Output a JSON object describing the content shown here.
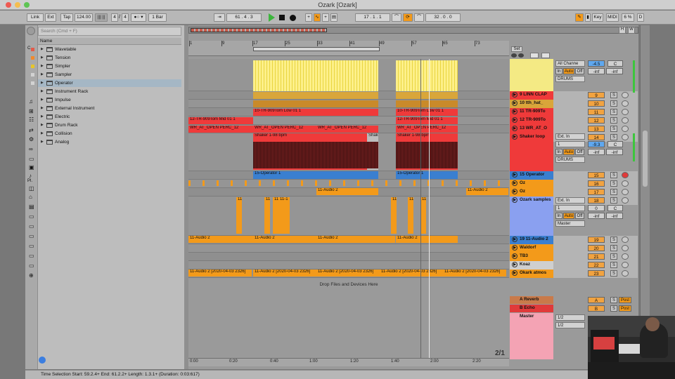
{
  "window": {
    "title": "Ozark  [Ozark]"
  },
  "control_bar": {
    "link": "Link",
    "ext": "Ext",
    "tap": "Tap",
    "tempo": "124.00",
    "sig_num": "4",
    "sig_den": "4",
    "quant": "1 Bar",
    "position": "61 .  4 .  3",
    "loop_start": "17 .  1 .  1",
    "loop_len": "32 .  0 .  0",
    "key": "Key",
    "midi": "MIDI",
    "cpu": "6 %",
    "d_btn": "D"
  },
  "browser": {
    "search_placeholder": "Search (Cmd + F)",
    "name_header": "Name",
    "items": [
      {
        "label": "Wavetable",
        "color": "#e35a4a"
      },
      {
        "label": "Tension",
        "color": "#f08a2d"
      },
      {
        "label": "Simpler",
        "color": "#e6c52a"
      },
      {
        "label": "Sampler",
        "color": "#d2d2d2"
      },
      {
        "label": "Operator",
        "color": "#d2d2d2"
      },
      {
        "label": "Instrument Rack"
      },
      {
        "label": "Impulse"
      },
      {
        "label": "External Instrument"
      },
      {
        "label": "Electric"
      },
      {
        "label": "Drum Rack"
      },
      {
        "label": "Collision"
      },
      {
        "label": "Analog"
      }
    ],
    "side_labels": [
      "C.",
      "Pl."
    ]
  },
  "ruler": {
    "bars": [
      "1",
      "9",
      "17",
      "25",
      "33",
      "41",
      "49",
      "57",
      "65",
      "73"
    ],
    "set_label": "Set"
  },
  "time_axis": [
    "0:00",
    "0:20",
    "0:40",
    "1:00",
    "1:20",
    "1:40",
    "2:00",
    "2:20"
  ],
  "arrangement": {
    "drop_text": "Drop Files and Devices Here",
    "page_indicator": "2/1",
    "clips": {
      "tom_low": "10-TR-909Tom Low 01 1",
      "tom_mid": "12-TR-909Tom Mid 01 1",
      "perc": "WR_AT_OPEN PERC_12",
      "shaker": "Shaker 1-98 bpm",
      "shaker_cut": "Shake",
      "operator": "15-Operator 1",
      "audio2": "11-Audio 2",
      "audio2_date": "11-Audio 2 [2020-04-03 2326]",
      "sample": "11-1"
    }
  },
  "tracks": [
    {
      "name": "9 LINN CLAP",
      "color": "#ef3a3a",
      "num": "9"
    },
    {
      "name": "10 tth_hat_",
      "color": "#d9a63a",
      "num": "10"
    },
    {
      "name": "11 TR-909To",
      "color": "#ef3a3a",
      "num": "11"
    },
    {
      "name": "12 TR-909To",
      "color": "#ef3a3a",
      "num": "12"
    },
    {
      "name": "13 WR_AT_O",
      "color": "#ef3a3a",
      "num": "13"
    },
    {
      "name": "Shaker loop",
      "color": "#ef3a3a",
      "num": "14"
    },
    {
      "name": "15 Operator",
      "color": "#3a7fd0",
      "num": "15"
    },
    {
      "name": "Oz",
      "color": "#f39a1a",
      "num": "16"
    },
    {
      "name": "Oz",
      "color": "#f39a1a",
      "num": "17"
    },
    {
      "name": "Ozark samples",
      "color": "#8aa0f0",
      "num": "18"
    },
    {
      "name": "19 11-Audio 2",
      "color": "#3a7fd0",
      "num": "19"
    },
    {
      "name": "Waldorf",
      "color": "#f39a1a",
      "num": "20"
    },
    {
      "name": "TB3",
      "color": "#f39a1a",
      "num": "21"
    },
    {
      "name": "Koaz",
      "color": "#cfcfcf",
      "num": "22"
    },
    {
      "name": "Okark atmos",
      "color": "#f39a1a",
      "num": "23"
    }
  ],
  "returns": [
    {
      "name": "A Reverb",
      "num": "A"
    },
    {
      "name": "B Echo",
      "num": "B"
    }
  ],
  "master": {
    "name": "Master",
    "out1": "1/2",
    "out2": "1/2"
  },
  "mixer": {
    "input_all": "All Channe",
    "drums": "DRUMS",
    "in": "In",
    "auto": "Auto",
    "off": "Off",
    "vol": "-4.5",
    "c": "C",
    "inf": "-inf",
    "ext_in": "Ext. In",
    "ch1": "1",
    "vol2": "-9.3",
    "zero": "0",
    "master_sel": "Master",
    "s": "S",
    "post": "Post"
  },
  "status": {
    "text": "Time Selection   Start: 59.2.4+   End: 61.2.2+   Length: 1.3.1+  (Duration: 0:03:617)"
  }
}
